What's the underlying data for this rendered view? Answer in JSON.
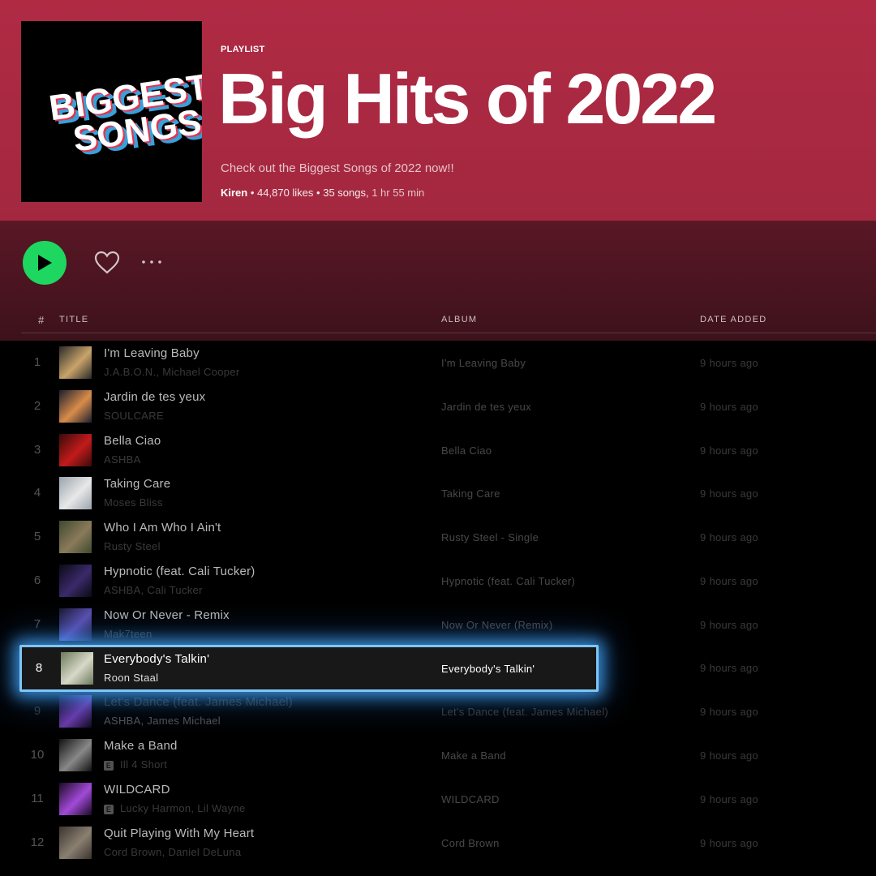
{
  "header": {
    "cover_line1": "BIGGEST",
    "cover_line2": "SONGS",
    "type_label": "PLAYLIST",
    "title": "Big Hits of 2022",
    "description": "Check out the Biggest Songs of 2022 now!!",
    "owner": "Kiren",
    "likes": "44,870 likes",
    "songs": "35 songs,",
    "duration": "1 hr 55 min",
    "bg_color": "#b02a44"
  },
  "actions": {
    "play_icon": "play-icon",
    "heart_icon": "heart-icon",
    "more_icon": "more-icon",
    "play_color": "#1ed760"
  },
  "columns": {
    "hash": "#",
    "title": "TITLE",
    "album": "ALBUM",
    "date_added": "DATE ADDED"
  },
  "tracks": [
    {
      "num": "1",
      "name": "I'm Leaving Baby",
      "artist": "J.A.B.O.N., Michael Cooper",
      "album": "I'm Leaving Baby",
      "date": "9 hours ago",
      "explicit": false
    },
    {
      "num": "2",
      "name": "Jardin de tes yeux",
      "artist": "SOULCARE",
      "album": "Jardin de tes yeux",
      "date": "9 hours ago",
      "explicit": false
    },
    {
      "num": "3",
      "name": "Bella Ciao",
      "artist": "ASHBA",
      "album": "Bella Ciao",
      "date": "9 hours ago",
      "explicit": false
    },
    {
      "num": "4",
      "name": "Taking Care",
      "artist": "Moses Bliss",
      "album": "Taking Care",
      "date": "9 hours ago",
      "explicit": false
    },
    {
      "num": "5",
      "name": "Who I Am Who I Ain't",
      "artist": "Rusty Steel",
      "album": "Rusty Steel - Single",
      "date": "9 hours ago",
      "explicit": false
    },
    {
      "num": "6",
      "name": "Hypnotic (feat. Cali Tucker)",
      "artist": "ASHBA, Cali Tucker",
      "album": "Hypnotic (feat. Cali Tucker)",
      "date": "9 hours ago",
      "explicit": false
    },
    {
      "num": "7",
      "name": "Now Or Never - Remix",
      "artist": "Mak7teen",
      "album": "Now Or Never (Remix)",
      "date": "9 hours ago",
      "explicit": false
    },
    {
      "num": "8",
      "name": "Everybody's Talkin'",
      "artist": "Roon Staal",
      "album": "Everybody's Talkin'",
      "date": "9 hours ago",
      "explicit": false,
      "selected": true
    },
    {
      "num": "9",
      "name": "Let's Dance (feat. James Michael)",
      "artist": "ASHBA, James Michael",
      "album": "Let's Dance (feat. James Michael)",
      "date": "9 hours ago",
      "explicit": false
    },
    {
      "num": "10",
      "name": "Make a Band",
      "artist": "Ill 4 Short",
      "album": "Make a Band",
      "date": "9 hours ago",
      "explicit": true
    },
    {
      "num": "11",
      "name": "WILDCARD",
      "artist": "Lucky Harmon, Lil Wayne",
      "album": "WILDCARD",
      "date": "9 hours ago",
      "explicit": true
    },
    {
      "num": "12",
      "name": "Quit Playing With My Heart",
      "artist": "Cord Brown, Daniel DeLuna",
      "album": "Cord Brown",
      "date": "9 hours ago",
      "explicit": false
    }
  ],
  "explicit_badge": "E"
}
